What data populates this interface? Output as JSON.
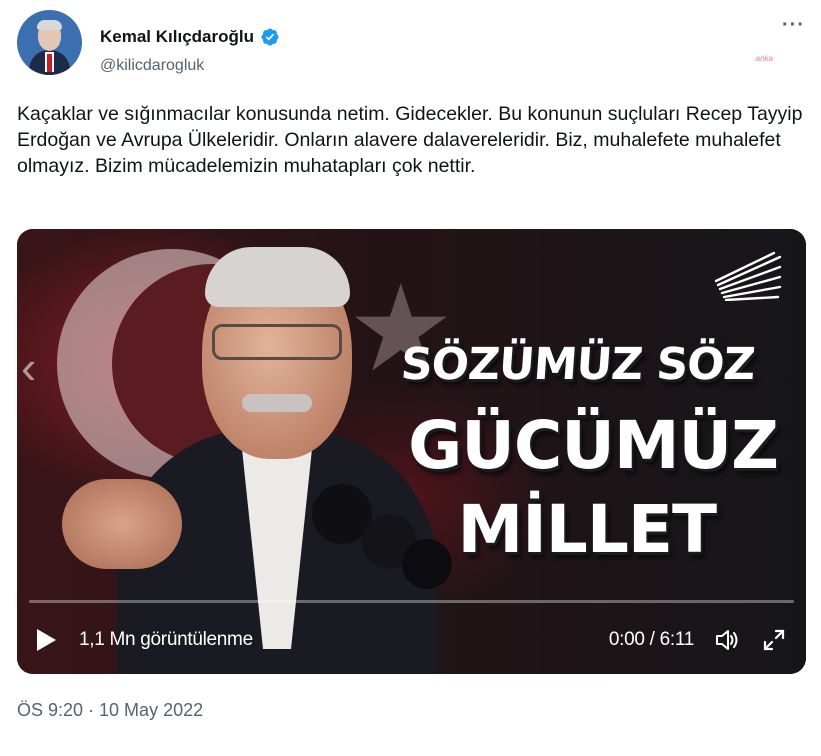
{
  "author": {
    "display_name": "Kemal Kılıçdaroğlu",
    "handle": "@kilicdarogluk",
    "verified": true,
    "avatar_icon": "profile-photo"
  },
  "tweet": {
    "text": "Kaçaklar ve sığınmacılar konusunda netim. Gidecekler. Bu konunun suçluları Recep Tayyip Erdoğan ve Avrupa Ülkeleridir. Onların alavere dalavereleridir. Biz, muhalefete muhalefet olmayız. Bizim mücadelemizin muhatapları çok nettir.",
    "timestamp": "ÖS 9:20 · 10 May 2022"
  },
  "watermark": "anka",
  "video": {
    "slogan_line1": "SÖZÜMÜZ SÖZ",
    "slogan_line2": "GÜCÜMÜZ",
    "slogan_line3": "MİLLET",
    "views": "1,1 Mn görüntülenme",
    "time": "0:00 / 6:11",
    "progress": 0,
    "icons": {
      "play": "play-icon",
      "volume": "volume-icon",
      "fullscreen": "fullscreen-icon",
      "previous": "chevron-left-icon"
    }
  },
  "colors": {
    "text": "#0f1419",
    "secondary": "#536471",
    "verified": "#1d9bf0"
  }
}
